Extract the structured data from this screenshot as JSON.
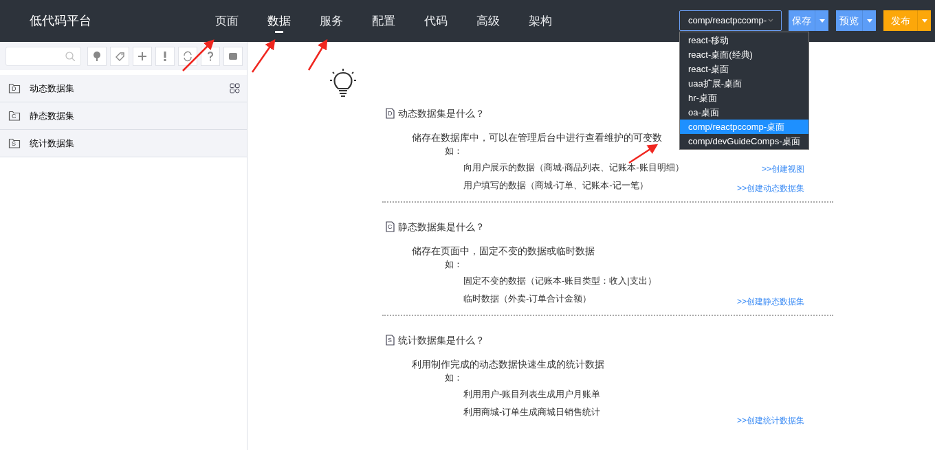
{
  "header": {
    "logo": "低代码平台",
    "tabs": [
      {
        "label": "页面",
        "selected": false
      },
      {
        "label": "数据",
        "selected": true
      },
      {
        "label": "服务",
        "selected": false
      },
      {
        "label": "配置",
        "selected": false
      },
      {
        "label": "代码",
        "selected": false
      },
      {
        "label": "高级",
        "selected": false
      },
      {
        "label": "架构",
        "selected": false
      }
    ],
    "template_select": {
      "value": "comp/reactpccomp-",
      "options": [
        {
          "label": "react-移动",
          "selected": false
        },
        {
          "label": "react-桌面(经典)",
          "selected": false
        },
        {
          "label": "react-桌面",
          "selected": false
        },
        {
          "label": "uaa扩展-桌面",
          "selected": false
        },
        {
          "label": "hr-桌面",
          "selected": false
        },
        {
          "label": "oa-桌面",
          "selected": false
        },
        {
          "label": "comp/reactpccomp-桌面",
          "selected": true
        },
        {
          "label": "comp/devGuideComps-桌面",
          "selected": false
        }
      ]
    },
    "buttons": [
      {
        "label": "保存",
        "kind": "secondary"
      },
      {
        "label": "预览",
        "kind": "secondary"
      },
      {
        "label": "发布",
        "kind": "primary"
      }
    ]
  },
  "sidebar": {
    "items": [
      {
        "label": "动态数据集",
        "letter": "D",
        "hovered": true
      },
      {
        "label": "静态数据集",
        "letter": "C",
        "hovered": false
      },
      {
        "label": "统计数据集",
        "letter": "S",
        "hovered": false
      }
    ]
  },
  "sections": [
    {
      "letter": "D",
      "title": "动态数据集是什么？",
      "description": "储存在数据库中，可以在管理后台中进行查看维护的可变数",
      "example_label": "如：",
      "examples": [
        "向用户展示的数据（商城-商品列表、记账本-账目明细）",
        "用户填写的数据（商城-订单、记账本-记一笔）"
      ],
      "links": [
        ">>创建视图",
        ">>创建动态数据集"
      ]
    },
    {
      "letter": "C",
      "title": "静态数据集是什么？",
      "description": "储存在页面中，固定不变的数据或临时数据",
      "example_label": "如：",
      "examples": [
        "固定不变的数据（记账本-账目类型：收入|支出）",
        "临时数据（外卖-订单合计金额）"
      ],
      "links": [
        ">>创建静态数据集"
      ]
    },
    {
      "letter": "S",
      "title": "统计数据集是什么？",
      "description": "利用制作完成的动态数据快速生成的统计数据",
      "example_label": "如：",
      "examples": [
        "利用用户-账目列表生成用户月账单",
        "利用商城-订单生成商城日销售统计"
      ],
      "links": [
        ">>创建统计数据集"
      ]
    }
  ]
}
